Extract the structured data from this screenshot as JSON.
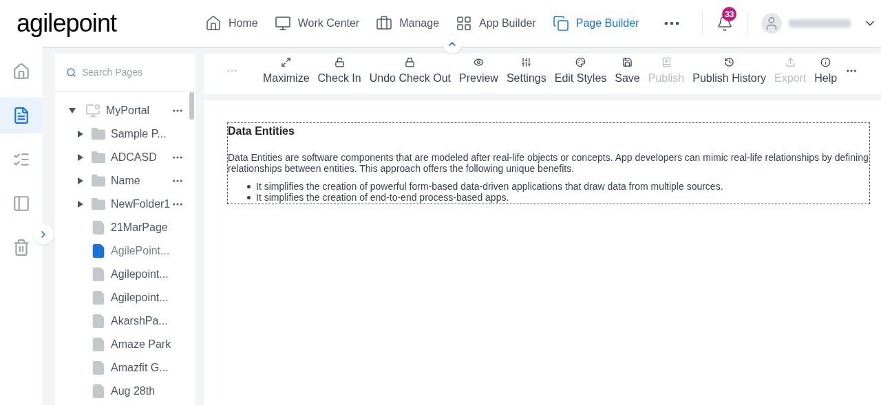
{
  "logo": {
    "text": "agilepoint"
  },
  "nav": [
    {
      "label": "Home",
      "selected": false
    },
    {
      "label": "Work Center",
      "selected": false
    },
    {
      "label": "Manage",
      "selected": false
    },
    {
      "label": "App Builder",
      "selected": false
    },
    {
      "label": "Page Builder",
      "selected": true
    }
  ],
  "notifications": {
    "count": "33"
  },
  "rail": [
    {
      "selected": false
    },
    {
      "selected": true
    },
    {
      "selected": false
    },
    {
      "selected": false
    },
    {
      "selected": false
    }
  ],
  "search": {
    "placeholder": "Search Pages"
  },
  "tree": {
    "label": "MyPortal",
    "expanded": true,
    "more": true,
    "children": [
      {
        "kind": "folder",
        "label": "Sample P...",
        "expanded": false,
        "more": false,
        "selected": false
      },
      {
        "kind": "folder",
        "label": "ADCASD",
        "expanded": false,
        "more": true,
        "selected": false
      },
      {
        "kind": "folder",
        "label": "Name",
        "expanded": false,
        "more": true,
        "selected": false
      },
      {
        "kind": "folder",
        "label": "NewFolder1",
        "expanded": false,
        "more": true,
        "selected": false
      },
      {
        "kind": "page",
        "label": "21MarPage",
        "more": false,
        "selected": false
      },
      {
        "kind": "page",
        "label": "AgilePoint...",
        "more": false,
        "selected": true
      },
      {
        "kind": "page",
        "label": "Agilepoint...",
        "more": false,
        "selected": false
      },
      {
        "kind": "page",
        "label": "Agilepoint...",
        "more": false,
        "selected": false
      },
      {
        "kind": "page",
        "label": "AkarshPa...",
        "more": false,
        "selected": false
      },
      {
        "kind": "page",
        "label": "Amaze Park",
        "more": false,
        "selected": false
      },
      {
        "kind": "page",
        "label": "Amazfit G...",
        "more": false,
        "selected": false
      },
      {
        "kind": "page",
        "label": "Aug 28th",
        "more": false,
        "selected": false
      }
    ]
  },
  "toolbar": [
    {
      "label": "Maximize",
      "disabled": false
    },
    {
      "label": "Check In",
      "disabled": false
    },
    {
      "label": "Undo Check Out",
      "disabled": false
    },
    {
      "label": "Preview",
      "disabled": false
    },
    {
      "label": "Settings",
      "disabled": false
    },
    {
      "label": "Edit Styles",
      "disabled": false
    },
    {
      "label": "Save",
      "disabled": false
    },
    {
      "label": "Publish",
      "disabled": true
    },
    {
      "label": "Publish History",
      "disabled": false
    },
    {
      "label": "Export",
      "disabled": true
    },
    {
      "label": "Help",
      "disabled": false
    }
  ],
  "content": {
    "heading": "Data Entities",
    "paragraph": "Data Entities are software components that are modeled after real-life objects or concepts. App developers can mimic real-life relationships by defining relationships between entities. This approach offers the following unique benefits.",
    "bullets": [
      "It simplifies the creation of powerful form-based data-driven applications that draw data from multiple sources.",
      "It simplifies the creation of end-to-end process-based apps."
    ]
  }
}
